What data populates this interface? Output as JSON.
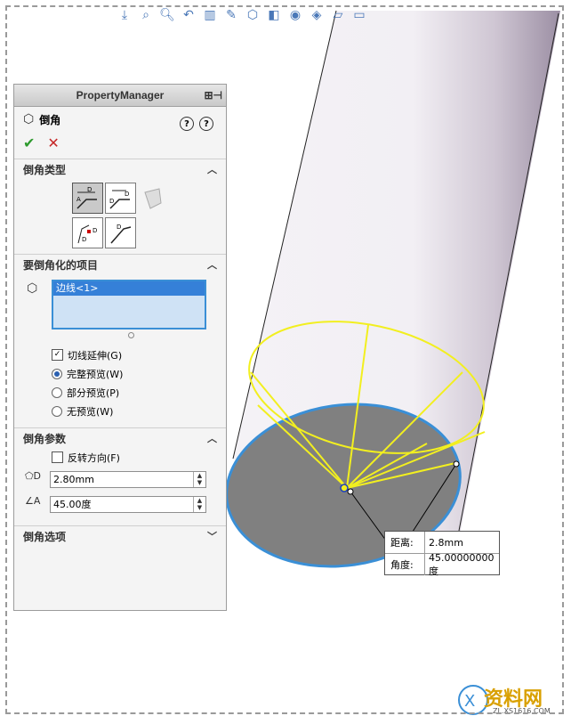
{
  "panel": {
    "header": "PropertyManager",
    "feature_title": "倒角",
    "help_1": "?",
    "help_2": "?",
    "ok": "✔",
    "cancel": "✕",
    "groups": {
      "type": "倒角类型",
      "items": "要倒角化的项目",
      "params": "倒角参数",
      "options": "倒角选项"
    },
    "items_list": [
      "边线<1>"
    ],
    "tangent_propagation": "切线延伸(G)",
    "preview_options": [
      "完整预览(W)",
      "部分预览(P)",
      "无预览(W)"
    ],
    "reverse_direction": "反转方向(F)",
    "distance_value": "2.80mm",
    "angle_value": "45.00度"
  },
  "callout": {
    "distance_label": "距离:",
    "distance_value": "2.8mm",
    "angle_label": "角度:",
    "angle_value": "45.00000000度"
  },
  "watermark": {
    "text": "资料网",
    "url": "ZL.XS1616.COM"
  },
  "colors": {
    "selection_yellow": "#f2ef1f",
    "edge_blue": "#3a8fd6",
    "face_gray": "#808080",
    "cylinder": "#d8d0dc"
  }
}
